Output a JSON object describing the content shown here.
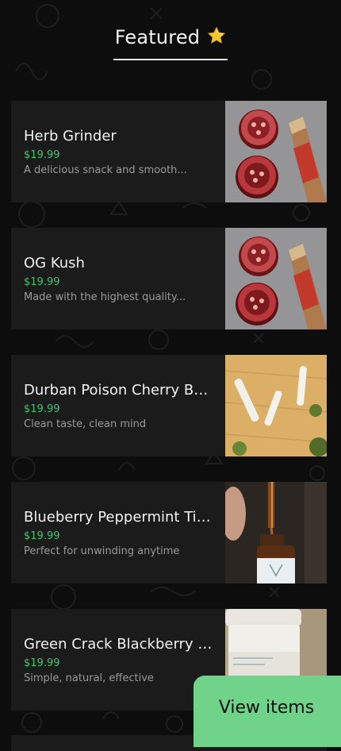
{
  "header": {
    "title": "Featured",
    "star_icon": "star-emoji-icon"
  },
  "items": [
    {
      "name": "Herb Grinder",
      "price": "$19.99",
      "description": "A delicious snack and smooth...",
      "image": "grinder-and-rolling-cones-photo"
    },
    {
      "name": "OG Kush",
      "price": "$19.99",
      "description": "Made with the highest quality...",
      "image": "grinder-and-rolling-cones-photo"
    },
    {
      "name": "Durban Poison Cherry Bo...",
      "price": "$19.99",
      "description": "Clean taste, clean mind",
      "image": "pre-rolls-on-wood-photo"
    },
    {
      "name": "Blueberry Peppermint Tin...",
      "price": "$19.99",
      "description": "Perfect for unwinding anytime",
      "image": "tincture-dropper-bottle-photo"
    },
    {
      "name": "Green Crack Blackberry K...",
      "price": "$19.99",
      "description": "Simple, natural, effective",
      "image": "white-jar-photo"
    }
  ],
  "view_button": {
    "label": "View items"
  },
  "colors": {
    "background": "#0d0d0d",
    "card": "#1b1b1c",
    "price": "#46c46e",
    "button": "#6fd38a"
  }
}
